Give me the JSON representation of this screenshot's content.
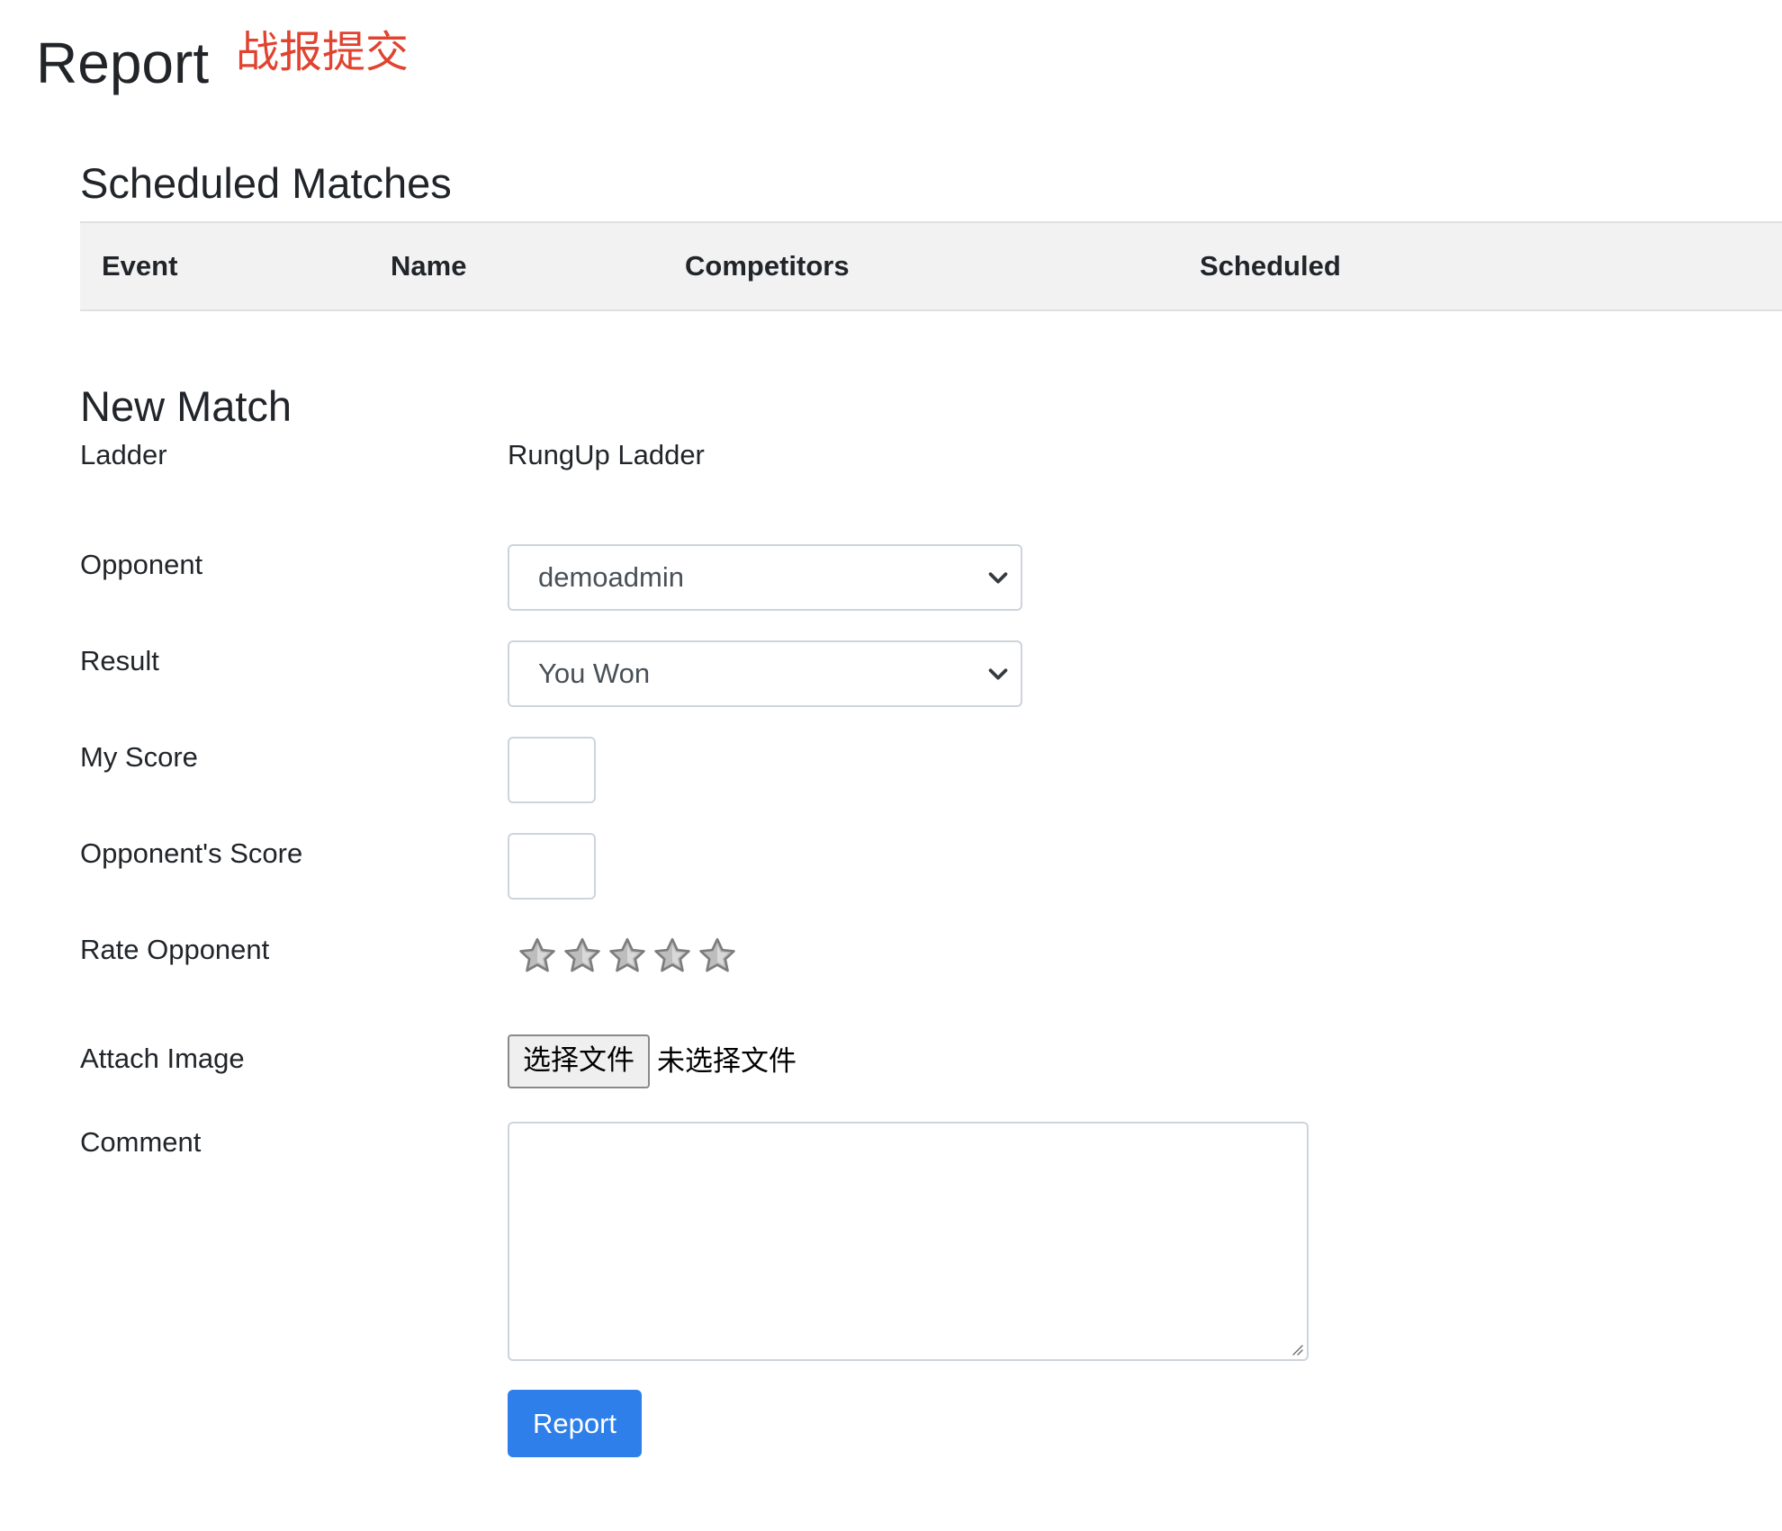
{
  "page": {
    "title": "Report",
    "annotation": "战报提交"
  },
  "colors": {
    "annotation": "#e0432f",
    "primary_button": "#2f7fea",
    "table_header_bg": "#f2f2f2",
    "input_border": "#ced4da"
  },
  "scheduled": {
    "title": "Scheduled Matches",
    "columns": [
      "Event",
      "Name",
      "Competitors",
      "Scheduled"
    ]
  },
  "new_match": {
    "title": "New Match",
    "ladder": {
      "label": "Ladder",
      "value": "RungUp Ladder"
    },
    "opponent": {
      "label": "Opponent",
      "selected": "demoadmin"
    },
    "result": {
      "label": "Result",
      "selected": "You Won"
    },
    "my_score": {
      "label": "My Score",
      "value": ""
    },
    "opponent_score": {
      "label": "Opponent's Score",
      "value": ""
    },
    "rating": {
      "label": "Rate Opponent",
      "max": 5,
      "value": 0
    },
    "attach": {
      "label": "Attach Image",
      "button": "选择文件",
      "status": "未选择文件"
    },
    "comment": {
      "label": "Comment",
      "value": ""
    },
    "submit_label": "Report"
  },
  "icons": {
    "select_arrow": "chevron-down-icon",
    "rating": "star-icon",
    "textarea_grip": "resize-grip-icon"
  }
}
